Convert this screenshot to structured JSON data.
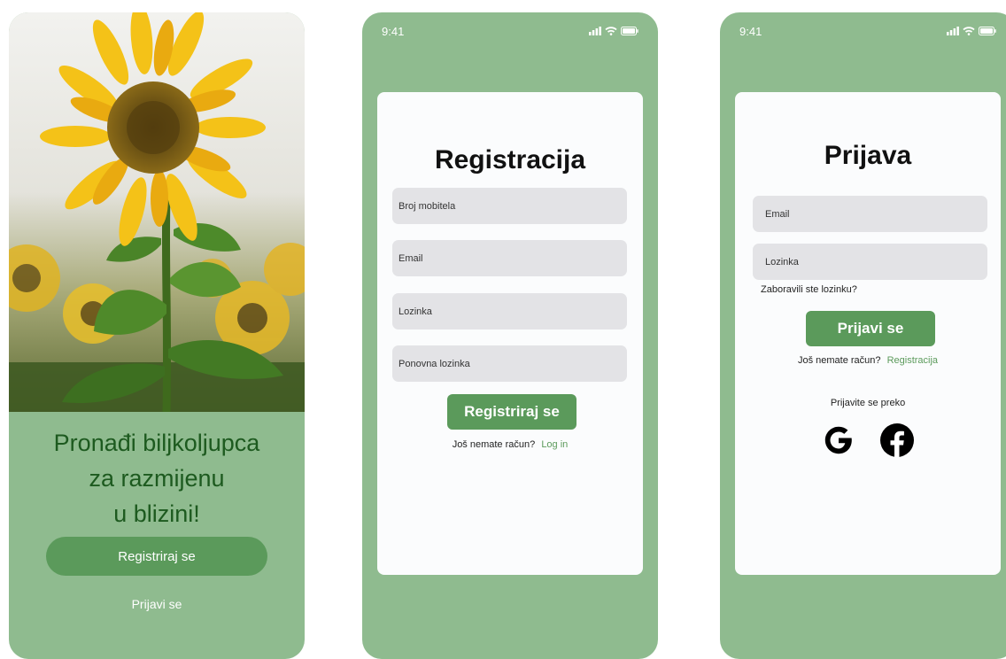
{
  "onboarding": {
    "tagline": "Pronađi biljkoljupca\nza razmijenu\nu blizini!",
    "register_button": "Registriraj se",
    "login_link": "Prijavi se"
  },
  "registration": {
    "status_time": "9:41",
    "title": "Registracija",
    "fields": {
      "phone_placeholder": "Broj mobitela",
      "email_placeholder": "Email",
      "password_placeholder": "Lozinka",
      "repeat_password_placeholder": "Ponovna lozinka"
    },
    "submit_button": "Registriraj se",
    "footer_text": "Još nemate račun?",
    "footer_link": "Log in"
  },
  "login": {
    "status_time": "9:41",
    "title": "Prijava",
    "fields": {
      "email_placeholder": "Email",
      "password_placeholder": "Lozinka"
    },
    "forgot_password": "Zaboravili ste lozinku?",
    "submit_button": "Prijavi se",
    "footer_text": "Još nemate račun?",
    "footer_link": "Registracija",
    "social_label": "Prijavite se preko",
    "social_icons": [
      "google-icon",
      "facebook-icon"
    ]
  },
  "colors": {
    "background_green": "#8fbb8f",
    "accent_green": "#5b9a5b",
    "tagline_green": "#1d5a1f",
    "field_gray": "#e3e3e6"
  }
}
